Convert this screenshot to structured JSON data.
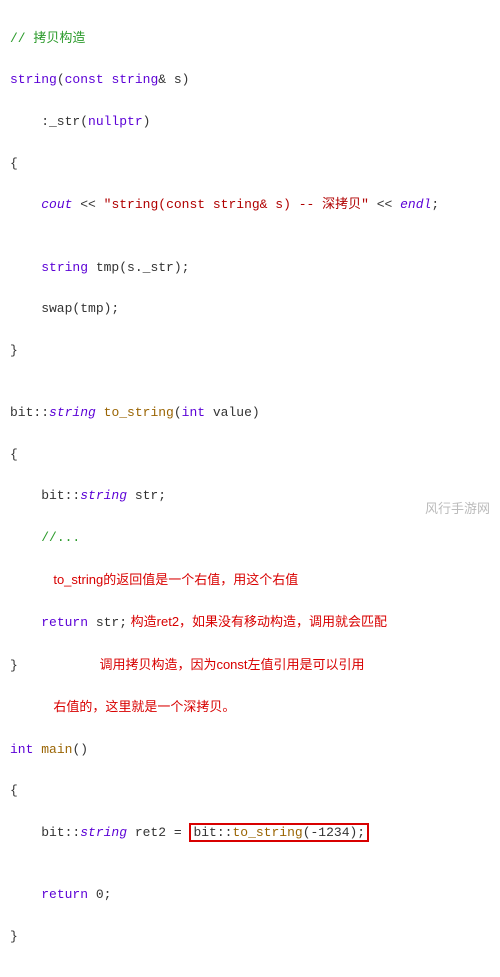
{
  "code": {
    "c1": "// 拷贝构造",
    "l2a": "string",
    "l2b": "(",
    "l2c": "const",
    "l2d": " ",
    "l2e": "string",
    "l2f": "& s)",
    "l3a": "    :_str(",
    "l3b": "nullptr",
    "l3c": ")",
    "l4": "{",
    "l5a": "    ",
    "l5b": "cout",
    "l5c": " << ",
    "l5d": "\"string(const string& s) -- 深拷贝\"",
    "l5e": " << ",
    "l5f": "endl",
    "l5g": ";",
    "blank1": "",
    "l6a": "    ",
    "l6b": "string",
    "l6c": " tmp(s._str);",
    "l7a": "    swap(tmp);",
    "l8": "}",
    "blank2": "",
    "l9a": "bit::",
    "l9b": "string",
    "l9c": " ",
    "l9d": "to_string",
    "l9e": "(",
    "l9f": "int",
    "l9g": " value)",
    "l10": "{",
    "l11a": "    bit::",
    "l11b": "string",
    "l11c": " str;",
    "l12a": "    ",
    "l12b": "//...",
    "annot1": "            to_string的返回值是一个右值，用这个右值",
    "l13a": "    ",
    "l13b": "return",
    "l13c": " str;",
    "annot2": " 构造ret2，如果没有移动构造，调用就会匹配",
    "l14": "}          ",
    "annot3": " 调用拷贝构造，因为const左值引用是可以引用",
    "annot4": "            右值的，这里就是一个深拷贝。",
    "l15a": "int",
    "l15b": " ",
    "l15c": "main",
    "l15d": "()",
    "l16": "{",
    "l17a": "    bit::",
    "l17b": "string",
    "l17c": " ret2 = ",
    "l17d": "bit::",
    "l17e": "to_string",
    "l17f": "(-1234);",
    "blank3": "",
    "l18a": "    ",
    "l18b": "return",
    "l18c": " 0;",
    "l19": "}"
  },
  "watermark": "风行手游网"
}
